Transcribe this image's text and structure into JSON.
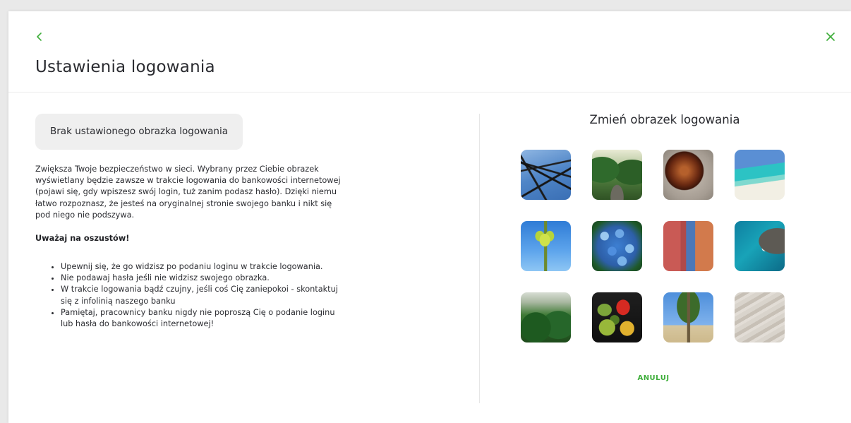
{
  "header": {
    "title": "Ustawienia logowania",
    "back_icon": "chevron-left-icon",
    "close_icon": "close-icon",
    "accent_color": "#3fae3b"
  },
  "left": {
    "status": "Brak ustawionego obrazka logowania",
    "description": "Zwiększa Twoje bezpieczeństwo w sieci. Wybrany przez Ciebie obrazek wyświetlany będzie zawsze w trakcie logowania do bankowości internetowej (pojawi się, gdy wpiszesz swój login, tuż zanim podasz hasło). Dzięki niemu łatwo rozpoznasz, że jesteś na oryginalnej stronie swojego banku i nikt się pod niego nie podszywa.",
    "warning_title": "Uważaj na oszustów!",
    "tips": [
      "Upewnij się, że go widzisz po podaniu loginu w trakcie logowania.",
      "Nie podawaj hasła jeśli nie widzisz swojego obrazka.",
      "W trakcie logowania bądź czujny, jeśli coś Cię zaniepokoi - skontaktuj się z infolinią naszego banku",
      "Pamiętaj, pracownicy banku nigdy nie poproszą Cię o podanie loginu lub hasła do bankowości internetowej!"
    ]
  },
  "right": {
    "title": "Zmień obrazek logowania",
    "images": [
      {
        "name": "power-lines-image"
      },
      {
        "name": "forest-road-image"
      },
      {
        "name": "chestnut-image"
      },
      {
        "name": "tropical-beach-image"
      },
      {
        "name": "plant-sprout-image"
      },
      {
        "name": "hydrangea-flower-image"
      },
      {
        "name": "painted-wall-image"
      },
      {
        "name": "rocky-coast-image"
      },
      {
        "name": "jungle-mist-image"
      },
      {
        "name": "vegetables-image"
      },
      {
        "name": "palm-tree-image"
      },
      {
        "name": "sand-texture-image"
      }
    ],
    "cancel_label": "ANULUJ"
  }
}
